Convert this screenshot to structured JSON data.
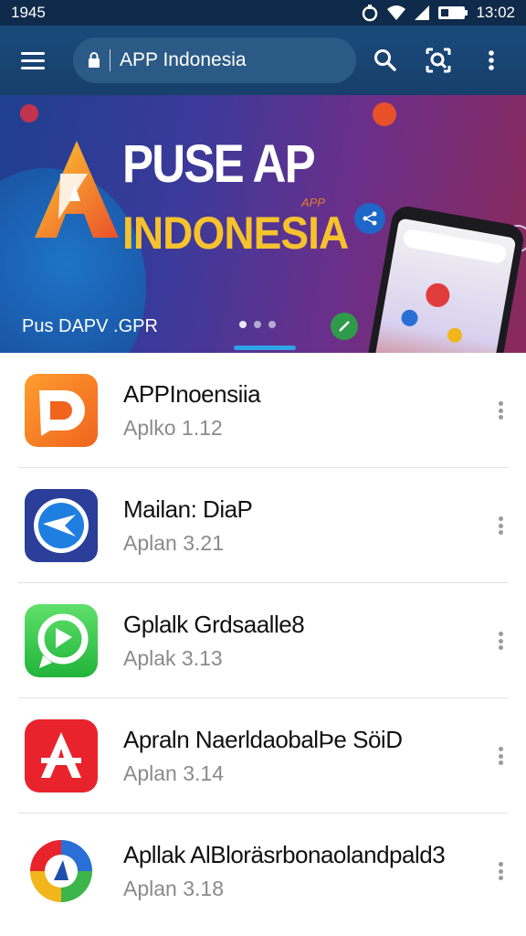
{
  "status_bar": {
    "time_left": "1945",
    "time_right": "13:02",
    "icons": [
      "notification-icon",
      "wifi-icon",
      "signal-icon",
      "battery-icon"
    ]
  },
  "app_bar": {
    "menu_icon": "hamburger-menu-icon",
    "search_value": "APP Indonesia",
    "lock_icon": "lock-icon",
    "search_icon": "search-icon",
    "lens_icon": "camera-search-icon",
    "overflow_icon": "more-vertical-icon"
  },
  "banner": {
    "title_line1": "PUSE AP",
    "title_line2": "INDONESIA",
    "small_label": "APP",
    "caption": "Pus DAPV .GPR",
    "page_count": 3,
    "active_page": 1
  },
  "apps": [
    {
      "title": "APPInoensiia",
      "subtitle": "Aplko 1.12",
      "icon": "app-indonesia-d-icon"
    },
    {
      "title": "Mailan: DiaP",
      "subtitle": "Aplan 3.21",
      "icon": "airplane-icon"
    },
    {
      "title": "Gplalk Grdsaalle8",
      "subtitle": "Aplak 3.13",
      "icon": "whatsapp-style-chat-icon"
    },
    {
      "title": "Apraln NaerldaobalÞe SöiD",
      "subtitle": "Aplan 3.14",
      "icon": "red-a-app-icon"
    },
    {
      "title": "Apllak AlBloräsrbonaolandpald3",
      "subtitle": "Aplan 3.18",
      "icon": "multicolor-pinwheel-icon"
    }
  ],
  "colors": {
    "status_bar": "#0f2a4a",
    "app_bar": "#1a4a7a",
    "accent": "#2ea3e8",
    "banner_title2": "#f6c22e"
  }
}
